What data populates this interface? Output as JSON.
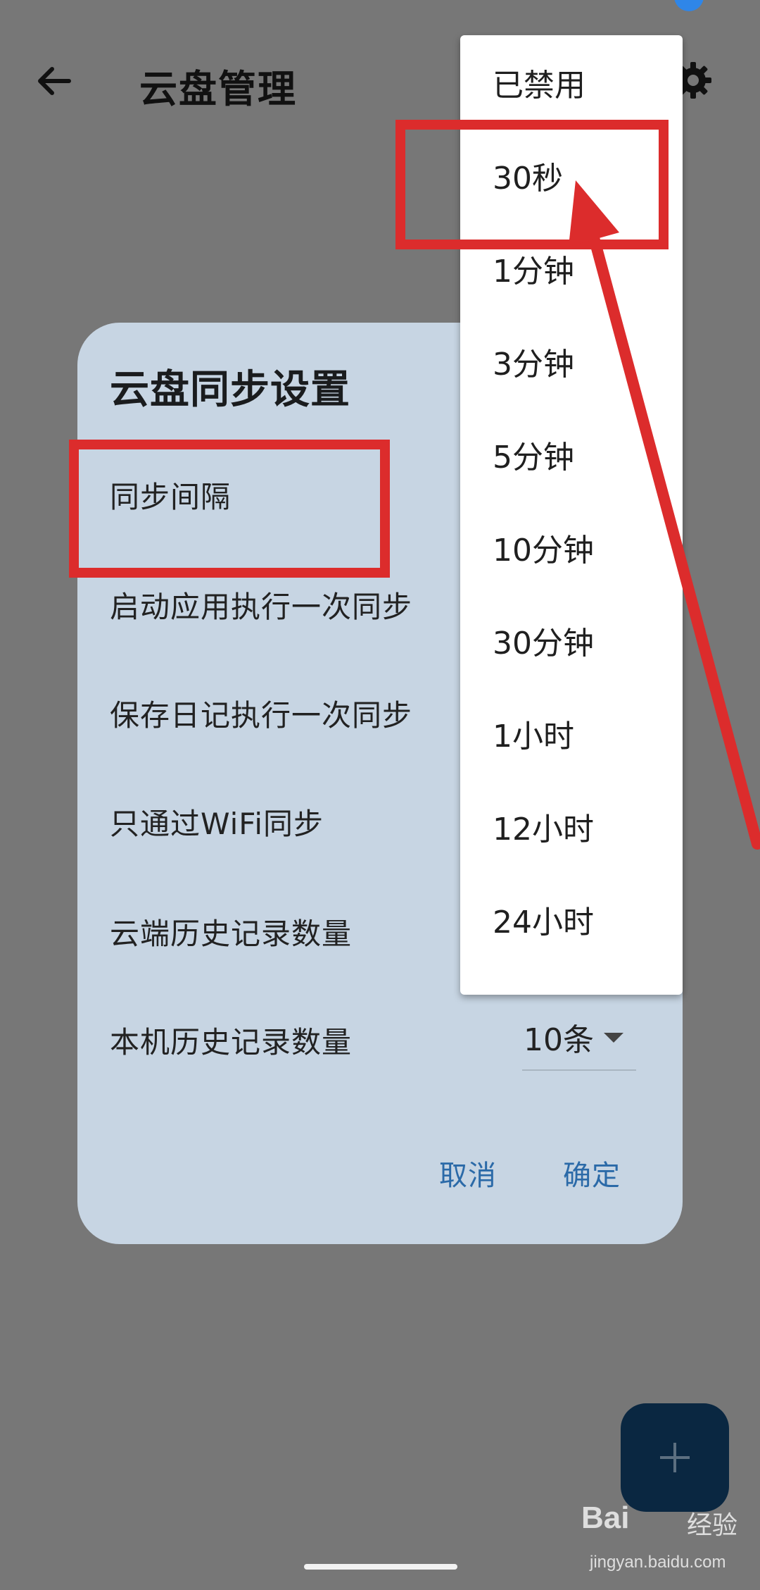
{
  "app_bar": {
    "title": "云盘管理",
    "back_icon": "arrow-left-icon",
    "settings_icon": "gear-icon"
  },
  "dialog": {
    "title": "云盘同步设置",
    "rows": [
      {
        "label": "同步间隔"
      },
      {
        "label": "启动应用执行一次同步"
      },
      {
        "label": "保存日记执行一次同步"
      },
      {
        "label": "只通过WiFi同步"
      },
      {
        "label": "云端历史记录数量"
      },
      {
        "label": "本机历史记录数量",
        "value": "10条"
      }
    ],
    "cancel_label": "取消",
    "confirm_label": "确定"
  },
  "interval_menu": {
    "options": [
      "已禁用",
      "30秒",
      "1分钟",
      "3分钟",
      "5分钟",
      "10分钟",
      "30分钟",
      "1小时",
      "12小时",
      "24小时"
    ]
  },
  "annotations": {
    "color": "#dc2c2c",
    "highlighted_option": "30秒",
    "highlighted_setting": "同步间隔"
  },
  "fab": {
    "icon": "plus-icon"
  },
  "watermark": {
    "brand": "Bai",
    "brand_suffix": "经验",
    "url": "jingyan.baidu.com"
  },
  "colors": {
    "scrim": "#777777",
    "dialog_bg": "#c7d5e3",
    "accent": "#2b6aa8",
    "fab_bg": "#0a2741"
  }
}
